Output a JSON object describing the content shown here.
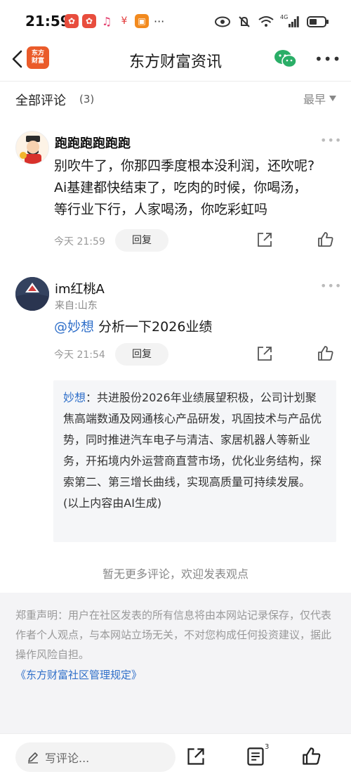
{
  "status_bar": {
    "time": "21:59",
    "network_label": "4G"
  },
  "header": {
    "title": "东方财富资讯",
    "logo_line1": "东方",
    "logo_line2": "财富"
  },
  "comments_header": {
    "title": "全部评论",
    "count": "(3)",
    "sort_label": "最早"
  },
  "comments": [
    {
      "username": "跑跑跑跑跑跑",
      "text_lines": [
        "别吹牛了，你那四季度根本没利润，还吹呢?",
        "Ai基建都快结束了，吃肉的时候，你喝汤，",
        "等行业下行，人家喝汤，你吃彩虹吗"
      ],
      "time": "今天 21:59",
      "reply_label": "回复"
    },
    {
      "username": "im红桃A",
      "location": "来自:山东",
      "mention": "@妙想",
      "text": " 分析一下2026业绩",
      "time": "今天 21:54",
      "reply_label": "回复"
    }
  ],
  "ai_reply": {
    "name": "妙想",
    "text": "：共进股份2026年业绩展望积极，公司计划聚焦高端数通及网通核心产品研发，巩固技术与产品优势，同时推进汽车电子与清洁、家居机器人等新业务，开拓境内外运营商直营市场，优化业务结构，探索第二、第三增长曲线，实现高质量可持续发展。",
    "note": "(以上内容由AI生成)"
  },
  "no_more_text": "暂无更多评论，欢迎发表观点",
  "disclaimer": "郑重声明：用户在社区发表的所有信息将由本网站记录保存，仅代表作者个人观点，与本网站立场无关，不对您构成任何投资建议，据此操作风险自担。",
  "rules_link": "《东方财富社区管理规定》",
  "bottom_bar": {
    "write_placeholder": "写评论...",
    "comment_badge": "3"
  },
  "colors": {
    "brand": "#ea5b2a",
    "link": "#2f6fc9",
    "wechat": "#2aae67"
  }
}
